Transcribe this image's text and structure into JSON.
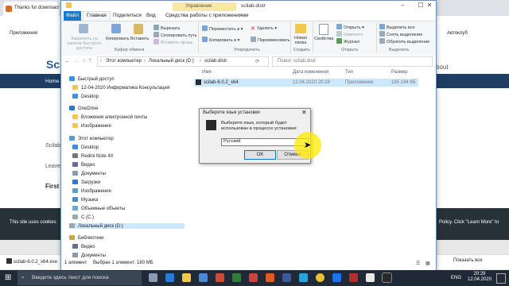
{
  "browser": {
    "tab_title": "Thanks for download",
    "bookmarks": [
      "Приложения",
      "Автоклуб"
    ],
    "site": {
      "logo_fragment": "Sc",
      "nav_home": "Home",
      "about_fragment": "bout",
      "text_fragments": [
        "Scilab",
        "Leave",
        "First"
      ],
      "cookie_left": "This site uses cookies",
      "cookie_right": "Policy. Click \"Learn More\" to"
    },
    "download_bar": {
      "item": "scilab-6.0.2_x64.exe",
      "show_all": "Показать все"
    }
  },
  "explorer": {
    "title": "scilab.distr",
    "context_tab_group": "Управление",
    "ribbon_tabs": [
      "Файл",
      "Главная",
      "Поделиться",
      "Вид",
      "Средства работы с приложениями"
    ],
    "clipboard": {
      "pin": "Закрепить на панели быстрого доступа",
      "copy": "Копировать",
      "paste": "Вставить",
      "cut": "Вырезать",
      "copy_path": "Скопировать путь",
      "paste_shortcut": "Вставить ярлык",
      "group": "Буфер обмена"
    },
    "organize": {
      "move_to": "Переместить в ▾",
      "copy_to": "Копировать в ▾",
      "delete": "Удалить ▾",
      "rename": "Переименовать",
      "group": "Упорядочить"
    },
    "create": {
      "new_folder": "Новая папка",
      "group": "Создать"
    },
    "open": {
      "properties": "Свойства",
      "open": "Открыть ▾",
      "edit": "Изменить",
      "history": "Журнал",
      "group": "Открыть"
    },
    "select": {
      "select_all": "Выделить все",
      "select_none": "Снять выделение",
      "invert": "Обратить выделение",
      "group": "Выделить"
    },
    "address": {
      "segments": [
        "Этот компьютер",
        "Локальный диск (D:)",
        "scilab.distr"
      ],
      "search_placeholder": "Поиск: scilab.distr"
    },
    "nav_items": [
      "Быстрый доступ",
      "12-04-2020 Информатика Консультация",
      "Desktop",
      "OneDrive",
      "Вложения электронной почты",
      "Изображения",
      "Этот компьютер",
      "Desktop",
      "Redmi Note 4X",
      "Видео",
      "Документы",
      "Загрузки",
      "Изображения",
      "Музыка",
      "Объемные объекты",
      "C (C:)",
      "Локальный диск (D:)",
      "Библиотеки",
      "Видео",
      "Документы"
    ],
    "columns": [
      "Имя",
      "Дата изменения",
      "Тип",
      "Размер"
    ],
    "files": [
      {
        "name": "scilab-6.0.2_x64",
        "date": "12.04.2020 20:28",
        "type": "Приложение",
        "size": "185 244 КБ"
      }
    ],
    "status": {
      "count": "1 элемент",
      "selected": "Выбран 1 элемент: 180 МБ"
    }
  },
  "dialog": {
    "title": "Выберите язык установки",
    "prompt": "Выберите язык, который будет использован в процессе установки:",
    "selected_language": "Русский",
    "ok": "OK",
    "cancel": "Отмена"
  },
  "taskbar": {
    "search_placeholder": "Введите здесь текст для поиска",
    "language": "ENG",
    "time": "20:29",
    "date": "12.04.2020"
  },
  "colors": {
    "accent": "#1979ca",
    "selection": "#cce8ff",
    "context_tab": "#f7e9a5",
    "taskbar": "#1f2a36"
  }
}
